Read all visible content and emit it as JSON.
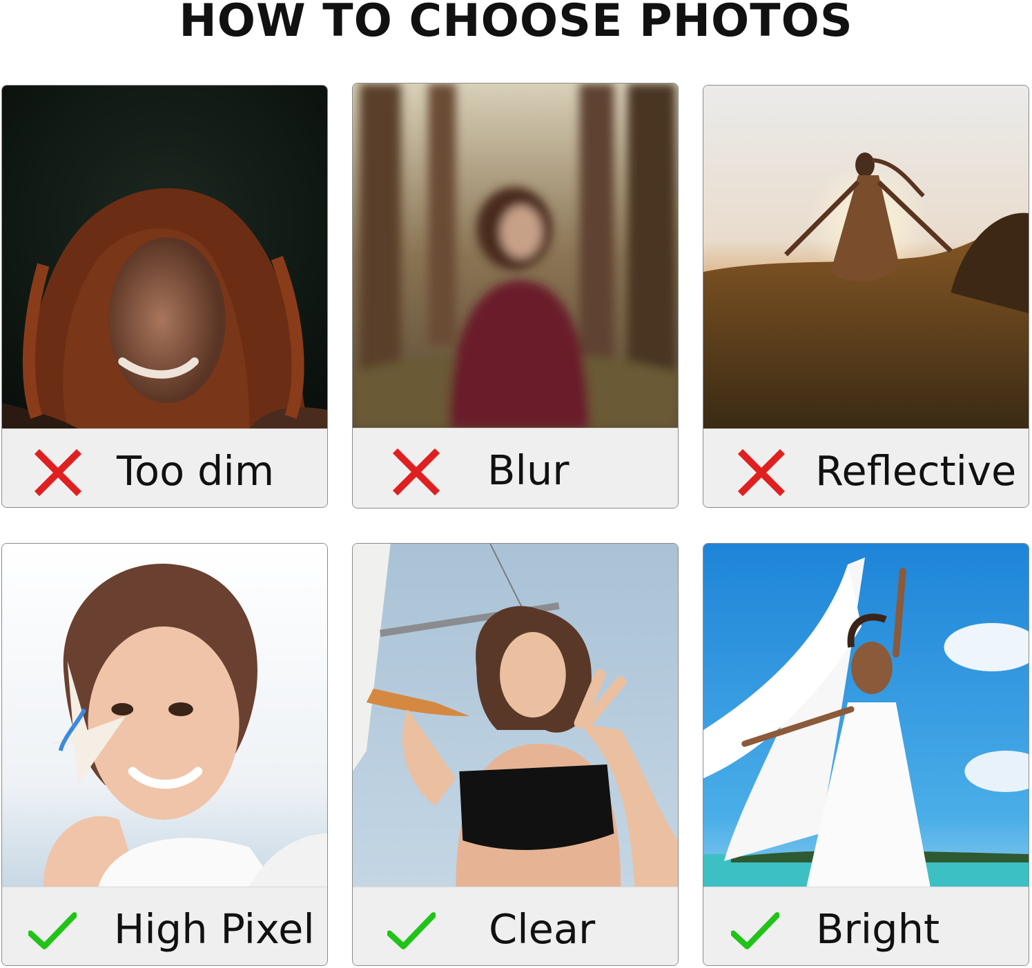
{
  "title": "HOW TO CHOOSE PHOTOS",
  "colors": {
    "cross": "#e02020",
    "check": "#22c318",
    "label_bg": "#efefef",
    "border": "#8a8a8a"
  },
  "cards": [
    {
      "label": "Too dim",
      "mark": "cross-icon",
      "verdict": "bad"
    },
    {
      "label": "Blur",
      "mark": "cross-icon",
      "verdict": "bad"
    },
    {
      "label": "Reflective",
      "mark": "cross-icon",
      "verdict": "bad"
    },
    {
      "label": "High Pixel",
      "mark": "check-icon",
      "verdict": "good"
    },
    {
      "label": "Clear",
      "mark": "check-icon",
      "verdict": "good"
    },
    {
      "label": "Bright",
      "mark": "check-icon",
      "verdict": "good"
    }
  ]
}
